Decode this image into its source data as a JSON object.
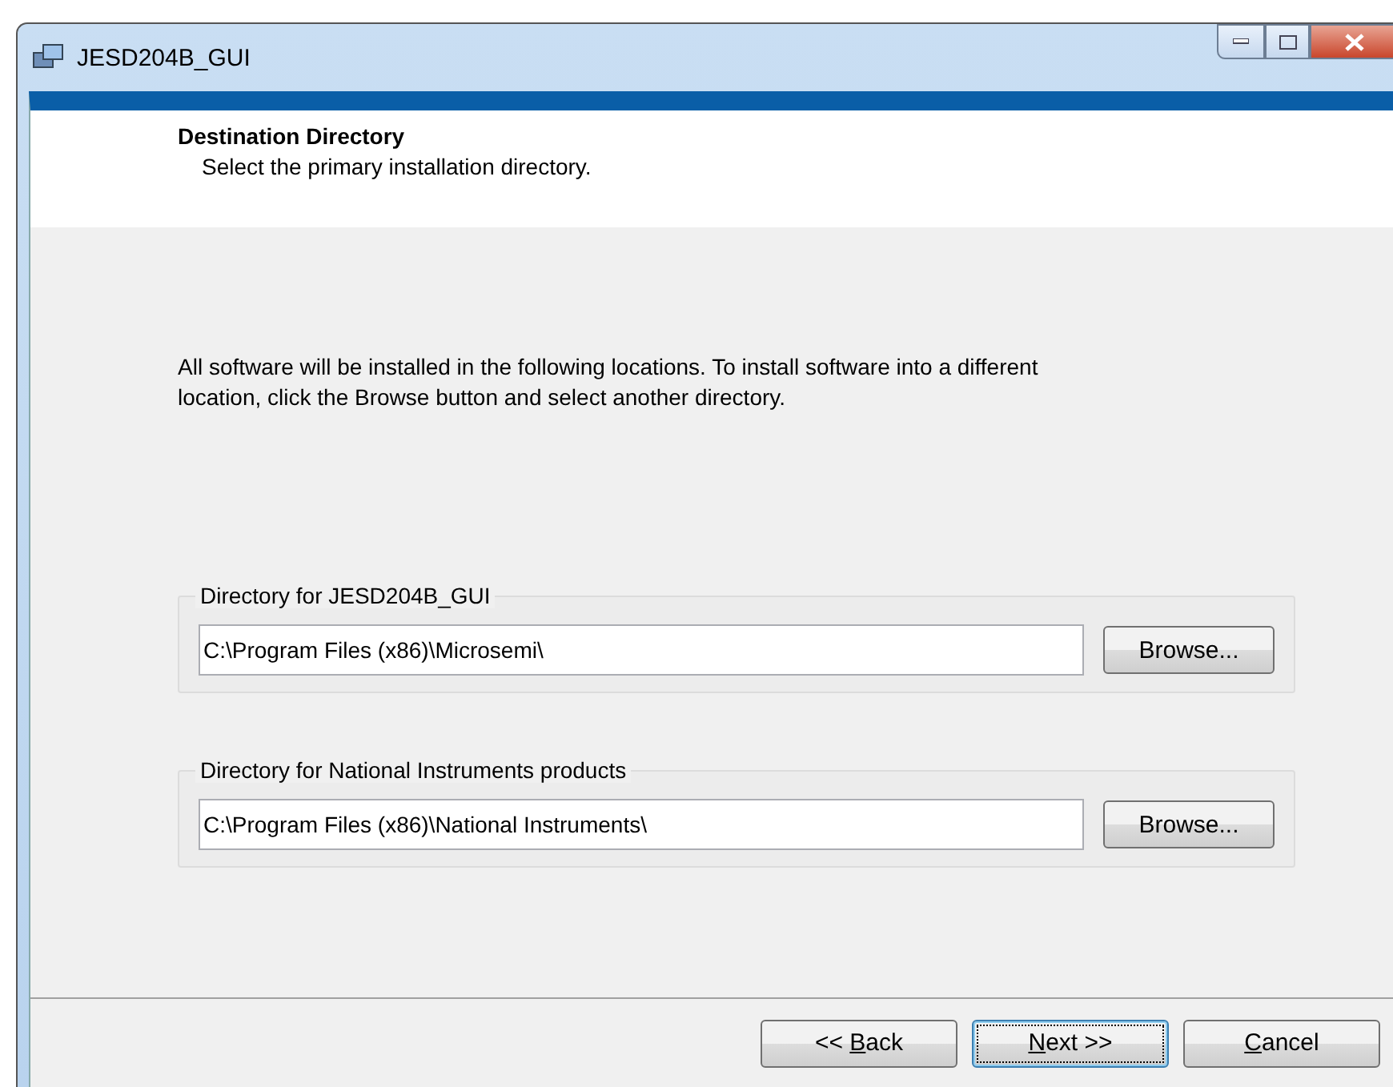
{
  "window": {
    "title": "JESD204B_GUI"
  },
  "header": {
    "title": "Destination Directory",
    "subtitle": "Select the primary installation directory."
  },
  "description": "All software will be installed in the following locations. To install software into a different location, click the Browse button and select another directory.",
  "directories": [
    {
      "label": "Directory for JESD204B_GUI",
      "value": "C:\\Program Files (x86)\\Microsemi\\",
      "button": "Browse..."
    },
    {
      "label": "Directory for National Instruments products",
      "value": "C:\\Program Files (x86)\\National Instruments\\",
      "button": "Browse..."
    }
  ],
  "buttons": [
    {
      "before": "<< ",
      "key": "B",
      "after": "ack",
      "focused": false
    },
    {
      "key": "N",
      "after": "ext >>",
      "focused": true
    },
    {
      "key": "C",
      "after": "ancel",
      "focused": false
    }
  ]
}
